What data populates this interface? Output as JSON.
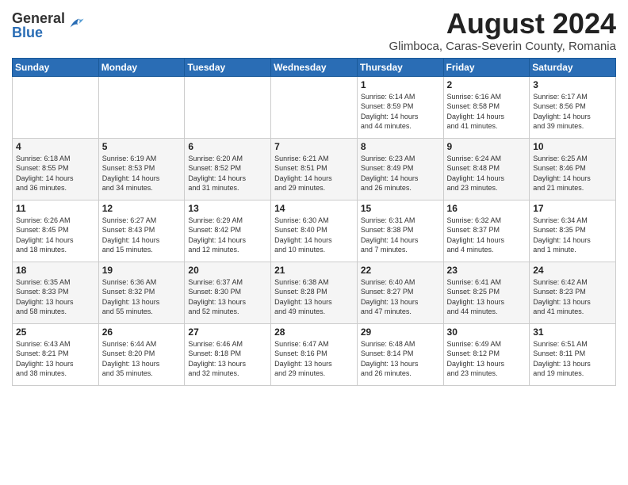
{
  "header": {
    "logo_general": "General",
    "logo_blue": "Blue",
    "month_year": "August 2024",
    "location": "Glimboca, Caras-Severin County, Romania"
  },
  "days_of_week": [
    "Sunday",
    "Monday",
    "Tuesday",
    "Wednesday",
    "Thursday",
    "Friday",
    "Saturday"
  ],
  "weeks": [
    [
      {
        "day": "",
        "info": ""
      },
      {
        "day": "",
        "info": ""
      },
      {
        "day": "",
        "info": ""
      },
      {
        "day": "",
        "info": ""
      },
      {
        "day": "1",
        "info": "Sunrise: 6:14 AM\nSunset: 8:59 PM\nDaylight: 14 hours\nand 44 minutes."
      },
      {
        "day": "2",
        "info": "Sunrise: 6:16 AM\nSunset: 8:58 PM\nDaylight: 14 hours\nand 41 minutes."
      },
      {
        "day": "3",
        "info": "Sunrise: 6:17 AM\nSunset: 8:56 PM\nDaylight: 14 hours\nand 39 minutes."
      }
    ],
    [
      {
        "day": "4",
        "info": "Sunrise: 6:18 AM\nSunset: 8:55 PM\nDaylight: 14 hours\nand 36 minutes."
      },
      {
        "day": "5",
        "info": "Sunrise: 6:19 AM\nSunset: 8:53 PM\nDaylight: 14 hours\nand 34 minutes."
      },
      {
        "day": "6",
        "info": "Sunrise: 6:20 AM\nSunset: 8:52 PM\nDaylight: 14 hours\nand 31 minutes."
      },
      {
        "day": "7",
        "info": "Sunrise: 6:21 AM\nSunset: 8:51 PM\nDaylight: 14 hours\nand 29 minutes."
      },
      {
        "day": "8",
        "info": "Sunrise: 6:23 AM\nSunset: 8:49 PM\nDaylight: 14 hours\nand 26 minutes."
      },
      {
        "day": "9",
        "info": "Sunrise: 6:24 AM\nSunset: 8:48 PM\nDaylight: 14 hours\nand 23 minutes."
      },
      {
        "day": "10",
        "info": "Sunrise: 6:25 AM\nSunset: 8:46 PM\nDaylight: 14 hours\nand 21 minutes."
      }
    ],
    [
      {
        "day": "11",
        "info": "Sunrise: 6:26 AM\nSunset: 8:45 PM\nDaylight: 14 hours\nand 18 minutes."
      },
      {
        "day": "12",
        "info": "Sunrise: 6:27 AM\nSunset: 8:43 PM\nDaylight: 14 hours\nand 15 minutes."
      },
      {
        "day": "13",
        "info": "Sunrise: 6:29 AM\nSunset: 8:42 PM\nDaylight: 14 hours\nand 12 minutes."
      },
      {
        "day": "14",
        "info": "Sunrise: 6:30 AM\nSunset: 8:40 PM\nDaylight: 14 hours\nand 10 minutes."
      },
      {
        "day": "15",
        "info": "Sunrise: 6:31 AM\nSunset: 8:38 PM\nDaylight: 14 hours\nand 7 minutes."
      },
      {
        "day": "16",
        "info": "Sunrise: 6:32 AM\nSunset: 8:37 PM\nDaylight: 14 hours\nand 4 minutes."
      },
      {
        "day": "17",
        "info": "Sunrise: 6:34 AM\nSunset: 8:35 PM\nDaylight: 14 hours\nand 1 minute."
      }
    ],
    [
      {
        "day": "18",
        "info": "Sunrise: 6:35 AM\nSunset: 8:33 PM\nDaylight: 13 hours\nand 58 minutes."
      },
      {
        "day": "19",
        "info": "Sunrise: 6:36 AM\nSunset: 8:32 PM\nDaylight: 13 hours\nand 55 minutes."
      },
      {
        "day": "20",
        "info": "Sunrise: 6:37 AM\nSunset: 8:30 PM\nDaylight: 13 hours\nand 52 minutes."
      },
      {
        "day": "21",
        "info": "Sunrise: 6:38 AM\nSunset: 8:28 PM\nDaylight: 13 hours\nand 49 minutes."
      },
      {
        "day": "22",
        "info": "Sunrise: 6:40 AM\nSunset: 8:27 PM\nDaylight: 13 hours\nand 47 minutes."
      },
      {
        "day": "23",
        "info": "Sunrise: 6:41 AM\nSunset: 8:25 PM\nDaylight: 13 hours\nand 44 minutes."
      },
      {
        "day": "24",
        "info": "Sunrise: 6:42 AM\nSunset: 8:23 PM\nDaylight: 13 hours\nand 41 minutes."
      }
    ],
    [
      {
        "day": "25",
        "info": "Sunrise: 6:43 AM\nSunset: 8:21 PM\nDaylight: 13 hours\nand 38 minutes."
      },
      {
        "day": "26",
        "info": "Sunrise: 6:44 AM\nSunset: 8:20 PM\nDaylight: 13 hours\nand 35 minutes."
      },
      {
        "day": "27",
        "info": "Sunrise: 6:46 AM\nSunset: 8:18 PM\nDaylight: 13 hours\nand 32 minutes."
      },
      {
        "day": "28",
        "info": "Sunrise: 6:47 AM\nSunset: 8:16 PM\nDaylight: 13 hours\nand 29 minutes."
      },
      {
        "day": "29",
        "info": "Sunrise: 6:48 AM\nSunset: 8:14 PM\nDaylight: 13 hours\nand 26 minutes."
      },
      {
        "day": "30",
        "info": "Sunrise: 6:49 AM\nSunset: 8:12 PM\nDaylight: 13 hours\nand 23 minutes."
      },
      {
        "day": "31",
        "info": "Sunrise: 6:51 AM\nSunset: 8:11 PM\nDaylight: 13 hours\nand 19 minutes."
      }
    ]
  ]
}
